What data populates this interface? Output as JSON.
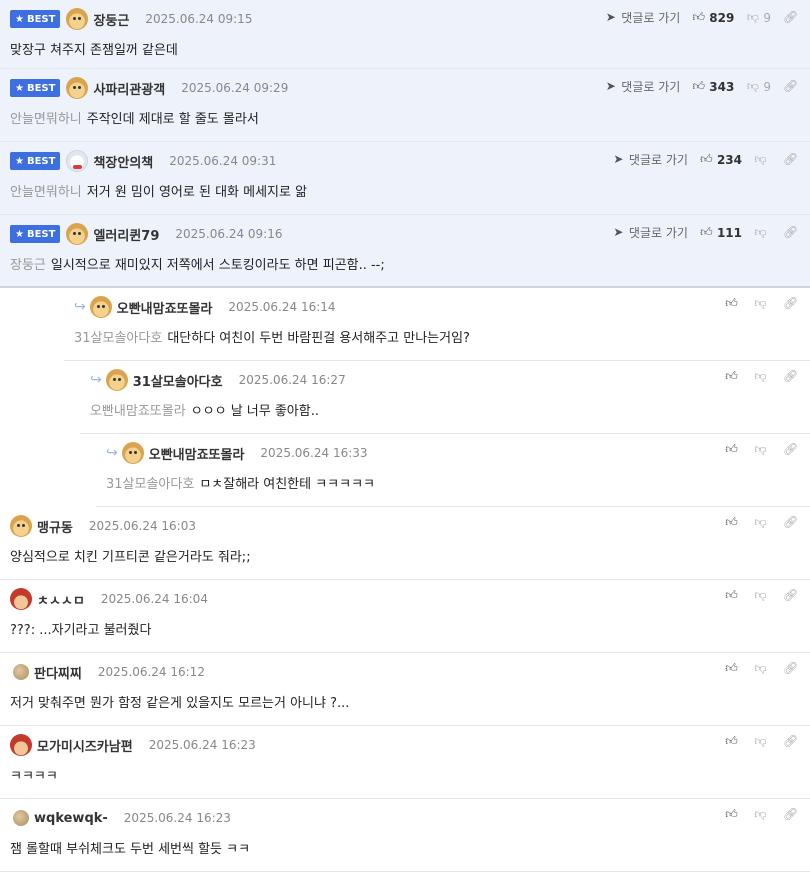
{
  "labels": {
    "best": "BEST",
    "goto": "댓글로 가기"
  },
  "colors": {
    "badge": "#3d6fe0",
    "best_bg": "#eef2fb"
  },
  "best": [
    {
      "nick": "장둥근",
      "date": "2025.06.24 09:15",
      "to": "",
      "text": "맞장구 쳐주지 존잼일꺼 같은데",
      "up": "829",
      "down": "9",
      "avatar": "dog-icon"
    },
    {
      "nick": "사파리관광객",
      "date": "2025.06.24 09:29",
      "to": "안늘면뭐하니",
      "text": "주작인데 제대로 할 줄도 몰라서",
      "up": "343",
      "down": "9",
      "avatar": "dog-icon"
    },
    {
      "nick": "책장안의책",
      "date": "2025.06.24 09:31",
      "to": "안늘면뭐하니",
      "text": "저거 원 밈이 영어로 된 대화 메세지로 앎",
      "up": "234",
      "down": "",
      "avatar": "bear-icon"
    },
    {
      "nick": "엘러리퀸79",
      "date": "2025.06.24 09:16",
      "to": "장둥근",
      "text": "일시적으로 재미있지 저쪽에서 스토킹이라도 하면 피곤함.. --;",
      "up": "111",
      "down": "",
      "avatar": "dog-icon"
    }
  ],
  "replies": [
    {
      "nick": "오빤내맘죠또몰라",
      "date": "2025.06.24 16:14",
      "to": "31살모솔아다호",
      "text": "대단하다 여친이 두번 바람핀걸 용서해주고 만나는거임?"
    },
    {
      "nick": "31살모솔아다호",
      "date": "2025.06.24 16:27",
      "to": "오빤내맘죠또몰라",
      "text": "ㅇㅇㅇ 날 너무 좋아함.."
    },
    {
      "nick": "오빤내맘죠또몰라",
      "date": "2025.06.24 16:33",
      "to": "31살모솔아다호",
      "text": "ㅁㅊ잘해라 여친한테 ㅋㅋㅋㅋㅋ"
    }
  ],
  "comments": [
    {
      "nick": "맹규동",
      "date": "2025.06.24 16:03",
      "text": "양심적으로 치킨 기프티콘 같은거라도 줘라;;",
      "avatar": "dog-icon"
    },
    {
      "nick": "ㅊㅅㅅㅁ",
      "date": "2025.06.24 16:04",
      "text": "???: ...자기라고 불러줬다",
      "avatar": "santa-icon"
    },
    {
      "nick": "판다찌찌",
      "date": "2025.06.24 16:12",
      "text": "저거 맞춰주면 뭔가 함정 같은게 있을지도 모르는거 아니냐 ?...",
      "avatar": "circle-icon"
    },
    {
      "nick": "모가미시즈카남편",
      "date": "2025.06.24 16:23",
      "text": "ㅋㅋㅋㅋ",
      "avatar": "santa-icon"
    },
    {
      "nick": "wqkewqk-",
      "date": "2025.06.24 16:23",
      "text": "잼 롤할때 부쉬체크도 두번 세번씩 할듯 ㅋㅋ",
      "avatar": "circle-icon"
    }
  ]
}
